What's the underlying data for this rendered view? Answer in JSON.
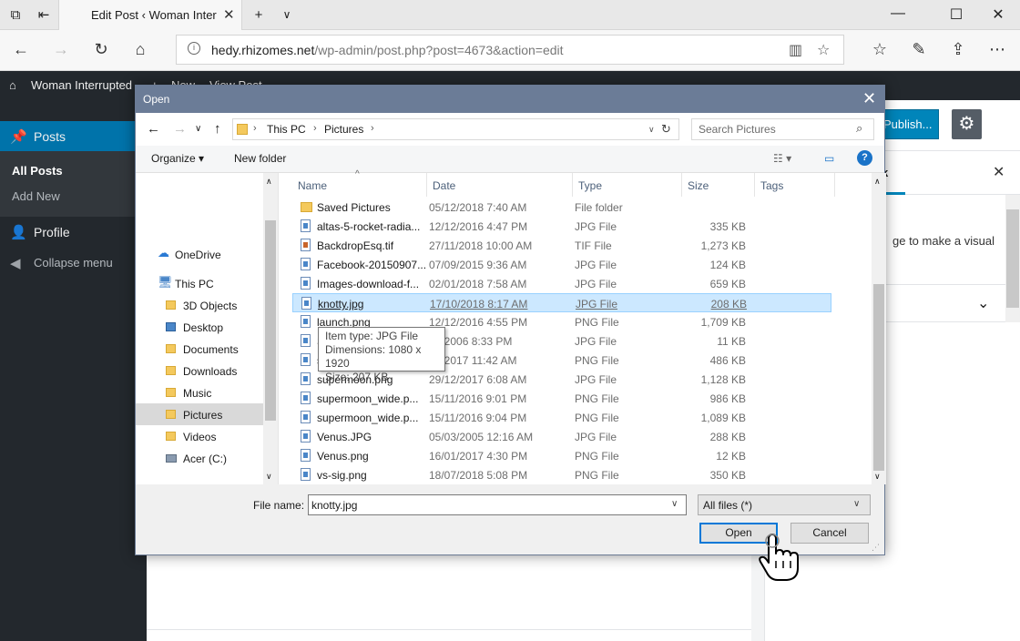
{
  "browser": {
    "tab_title": "Edit Post ‹ Woman Inter",
    "url_host": "hedy.rhizomes.net",
    "url_path": "/wp-admin/post.php?post=4673&action=edit"
  },
  "wp": {
    "site_name": "Woman Interrupted",
    "new_label": "New",
    "view_post": "View Post",
    "menu": {
      "posts": "Posts",
      "all_posts": "All Posts",
      "add_new": "Add New",
      "profile": "Profile",
      "collapse": "Collapse menu"
    },
    "publish": "Publish...",
    "sidebar_tab": "k",
    "sidebar_text": "ge to make a visual"
  },
  "dialog": {
    "title": "Open",
    "breadcrumb": [
      "This PC",
      "Pictures"
    ],
    "search_placeholder": "Search Pictures",
    "organize": "Organize",
    "new_folder": "New folder",
    "nav_items": [
      {
        "label": "OneDrive",
        "icon": "cloud-icon"
      },
      {
        "label": "This PC",
        "icon": "computer-icon"
      },
      {
        "label": "3D Objects",
        "icon": "folder-icon"
      },
      {
        "label": "Desktop",
        "icon": "folder-icon"
      },
      {
        "label": "Documents",
        "icon": "folder-icon"
      },
      {
        "label": "Downloads",
        "icon": "folder-icon"
      },
      {
        "label": "Music",
        "icon": "folder-icon"
      },
      {
        "label": "Pictures",
        "icon": "folder-icon"
      },
      {
        "label": "Videos",
        "icon": "folder-icon"
      },
      {
        "label": "Acer (C:)",
        "icon": "drive-icon"
      }
    ],
    "columns": [
      "Name",
      "Date",
      "Type",
      "Size",
      "Tags"
    ],
    "files": [
      {
        "name": "Saved Pictures",
        "date": "05/12/2018 7:40 AM",
        "type": "File folder",
        "size": "",
        "icon": "folder"
      },
      {
        "name": "altas-5-rocket-radia...",
        "date": "12/12/2016 4:47 PM",
        "type": "JPG File",
        "size": "335 KB",
        "icon": "image"
      },
      {
        "name": "BackdropEsq.tif",
        "date": "27/11/2018 10:00 AM",
        "type": "TIF File",
        "size": "1,273 KB",
        "icon": "tif"
      },
      {
        "name": "Facebook-20150907...",
        "date": "07/09/2015 9:36 AM",
        "type": "JPG File",
        "size": "124 KB",
        "icon": "image"
      },
      {
        "name": "Images-download-f...",
        "date": "02/01/2018 7:58 AM",
        "type": "JPG File",
        "size": "659 KB",
        "icon": "image"
      },
      {
        "name": "knotty.jpg",
        "date": "17/10/2018 8:17 AM",
        "type": "JPG File",
        "size": "208 KB",
        "icon": "image",
        "selected": true
      },
      {
        "name": "launch.png",
        "date": "12/12/2016 4:55 PM",
        "type": "PNG File",
        "size": "1,709 KB",
        "icon": "image"
      },
      {
        "name": "S",
        "date": "08/2006 8:33 PM",
        "type": "JPG File",
        "size": "11 KB",
        "icon": "image"
      },
      {
        "name": "s",
        "date": "03/2017 11:42 AM",
        "type": "PNG File",
        "size": "486 KB",
        "icon": "image"
      },
      {
        "name": "supermoon.png",
        "date": "29/12/2017 6:08 AM",
        "type": "JPG File",
        "size": "1,128 KB",
        "icon": "image"
      },
      {
        "name": "supermoon_wide.p...",
        "date": "15/11/2016 9:01 PM",
        "type": "PNG File",
        "size": "986 KB",
        "icon": "image"
      },
      {
        "name": "supermoon_wide.p...",
        "date": "15/11/2016 9:04 PM",
        "type": "PNG File",
        "size": "1,089 KB",
        "icon": "image"
      },
      {
        "name": "Venus.JPG",
        "date": "05/03/2005 12:16 AM",
        "type": "JPG File",
        "size": "288 KB",
        "icon": "image"
      },
      {
        "name": "Venus.png",
        "date": "16/01/2017 4:30 PM",
        "type": "PNG File",
        "size": "12 KB",
        "icon": "image"
      },
      {
        "name": "vs-sig.png",
        "date": "18/07/2018 5:08 PM",
        "type": "PNG File",
        "size": "350 KB",
        "icon": "image"
      }
    ],
    "tooltip": {
      "type": "Item type: JPG File",
      "dims": "Dimensions: 1080 x 1920",
      "size": "Size: 207 KB"
    },
    "file_name_label": "File name:",
    "file_name_value": "knotty.jpg",
    "file_type": "All files (*)",
    "open_button": "Open",
    "cancel_button": "Cancel"
  }
}
